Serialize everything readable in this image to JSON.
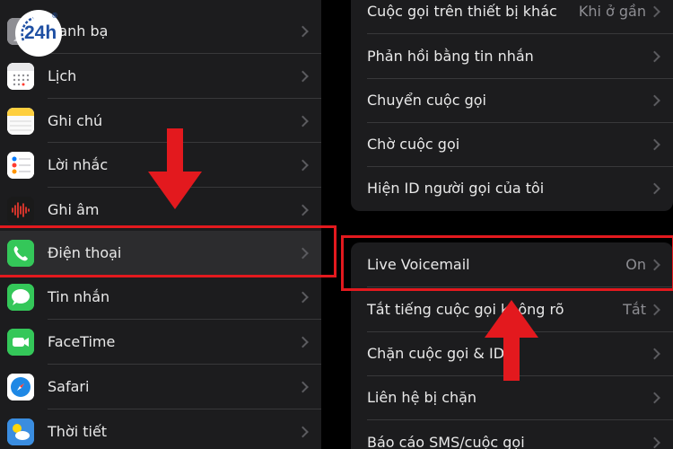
{
  "logo": {
    "text": "24h",
    "reg": "®"
  },
  "left_menu": {
    "items": [
      {
        "label": "Danh bạ",
        "icon": "contacts-icon"
      },
      {
        "label": "Lịch",
        "icon": "calendar-icon"
      },
      {
        "label": "Ghi chú",
        "icon": "notes-icon"
      },
      {
        "label": "Lời nhắc",
        "icon": "reminders-icon"
      },
      {
        "label": "Ghi âm",
        "icon": "voice-memos-icon"
      },
      {
        "label": "Điện thoại",
        "icon": "phone-icon",
        "selected": true
      },
      {
        "label": "Tin nhắn",
        "icon": "messages-icon"
      },
      {
        "label": "FaceTime",
        "icon": "facetime-icon"
      },
      {
        "label": "Safari",
        "icon": "safari-icon"
      },
      {
        "label": "Thời tiết",
        "icon": "weather-icon"
      }
    ]
  },
  "phone_settings": {
    "group1": [
      {
        "label": "Cuộc gọi trên thiết bị khác",
        "value": "Khi ở gần"
      },
      {
        "label": "Phản hồi bằng tin nhắn"
      },
      {
        "label": "Chuyển cuộc gọi"
      },
      {
        "label": "Chờ cuộc gọi"
      },
      {
        "label": "Hiện ID người gọi của tôi"
      }
    ],
    "group2": [
      {
        "label": "Live Voicemail",
        "value": "On"
      },
      {
        "label": "Tắt tiếng cuộc gọi không rõ",
        "value": "Tắt"
      },
      {
        "label": "Chặn cuộc gọi & ID"
      },
      {
        "label": "Liên hệ bị chặn"
      },
      {
        "label": "Báo cáo SMS/cuộc gọi"
      }
    ]
  },
  "colors": {
    "annotation": "#e3191e",
    "phone_green": "#34c759"
  }
}
